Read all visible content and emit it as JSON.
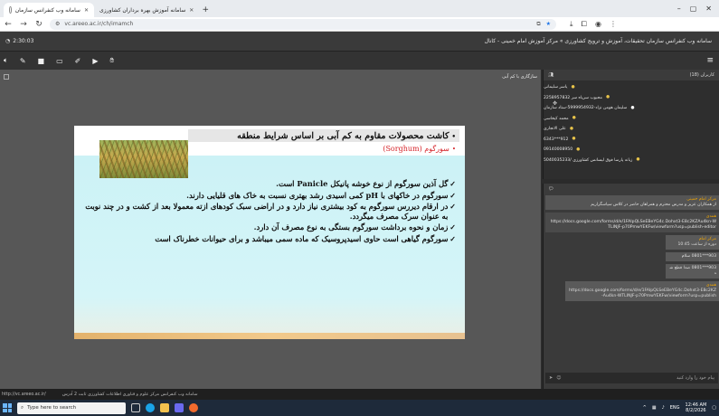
{
  "browser": {
    "tabs": [
      {
        "title": "سامانه وب کنفرانس سازمان",
        "active": true
      },
      {
        "title": "سامانه آموزش بهره برداران کشاورزی",
        "active": false
      }
    ],
    "new_tab": "+",
    "url": "vc.areeo.ac.ir/ch/imamch",
    "window_controls": [
      "–",
      "▢",
      "✕"
    ]
  },
  "app": {
    "timer": "2:30:03",
    "title": "سامانه وب کنفرانس سازمان تحقیقات، آموزش و ترویج کشاورزی » مرکز آموزش امام خمینی - کانال"
  },
  "stage": {
    "pod_title": "سازگاری با کم آبی"
  },
  "slide": {
    "title": "کاشت محصولات مقاوم به کم آبی بر اساس شرایط منطقه",
    "subtitle": "سورگوم (Sorghum)",
    "items": [
      "گل آذین سورگوم از نوع خوشه پانیکل Panicle است.",
      "سورگوم در خاکهای با pH کمی اسیدی رشد بهتری نسبت به خاک های قلیایی دارند.",
      "در ارقام دیررس سورگوم به کود بیشتری نیاز دارد و در اراضی سبک کودهای ازته معمولا بعد از کشت و در چند نوبت به عنوان سرک مصرف میگردد.",
      "زمان و نحوه برداشت سورگوم بستگی به نوع مصرف آن دارد.",
      "سورگوم گیاهی است حاوی اسیدپروسیک که ماده سمی میباشد و برای حیوانات خطرناک است"
    ]
  },
  "attendees": {
    "header": "کاربران (18)",
    "list": [
      {
        "name": "یاسر سلیمانی",
        "color": "yellow"
      },
      {
        "name": "محبوب سرپاه سر 2258957832",
        "color": "yellow"
      },
      {
        "name": "سلیمان هومن نژاد-5999954932-ستاد سازمان",
        "color": "white"
      },
      {
        "name": "محمد کیخاسی",
        "color": "yellow"
      },
      {
        "name": "علی الانجاری",
        "color": "yellow"
      },
      {
        "name": "912***6343",
        "color": "yellow"
      },
      {
        "name": "09140008950",
        "color": "yellow"
      },
      {
        "name": "زبانه پارسا فوق لیسانس کشاورزی /5040035233",
        "color": "yellow"
      }
    ]
  },
  "chat": {
    "messages": [
      {
        "who": "مرکز امام خمینی",
        "text": "از همکاران عزیز و مدرس محترم و همراهان حاضر در کلاس سپاسگزاریم",
        "style": "grey"
      },
      {
        "who": "همدی",
        "text": "https://docs.google.com/forms/d/e/1FAIpQLSeEBeYG4c.Dohxt3-E8c2KZAu4kn-WTLINJF-p70PmwYEKFw/viewform?usp=publish-editor",
        "style": "dark"
      },
      {
        "who": "مرکز امام",
        "text": "دوره از ساعت 10:45",
        "style": "narrow"
      },
      {
        "who": "",
        "text": "903***0801 سلام",
        "style": "narrow"
      },
      {
        "who": "",
        "text": "903***0801 صدا قطع شد",
        "style": "narrow"
      },
      {
        "who": "همدی",
        "text": "https://docs.google.com/forms/d/e/1FAIpQLSeEBeYG4c.Dohxt3-E8c2KZAu4kn-WTLINJF-p70PmwYEKFw/viewform?usp=publish-",
        "style": "mid"
      }
    ],
    "input_placeholder": "پیام خود را وارد کنید"
  },
  "status": {
    "left": "http://vc.areeo.ac.ir/",
    "right": "سامانه وب کنفرانس مرکز علوم و فناوری اطلاعات کشاورزی ثابت 2 آدرس"
  },
  "taskbar": {
    "search_placeholder": "Type here to search",
    "time": "12:46 AM",
    "date": "8/2/2026",
    "lang": "ENG"
  }
}
